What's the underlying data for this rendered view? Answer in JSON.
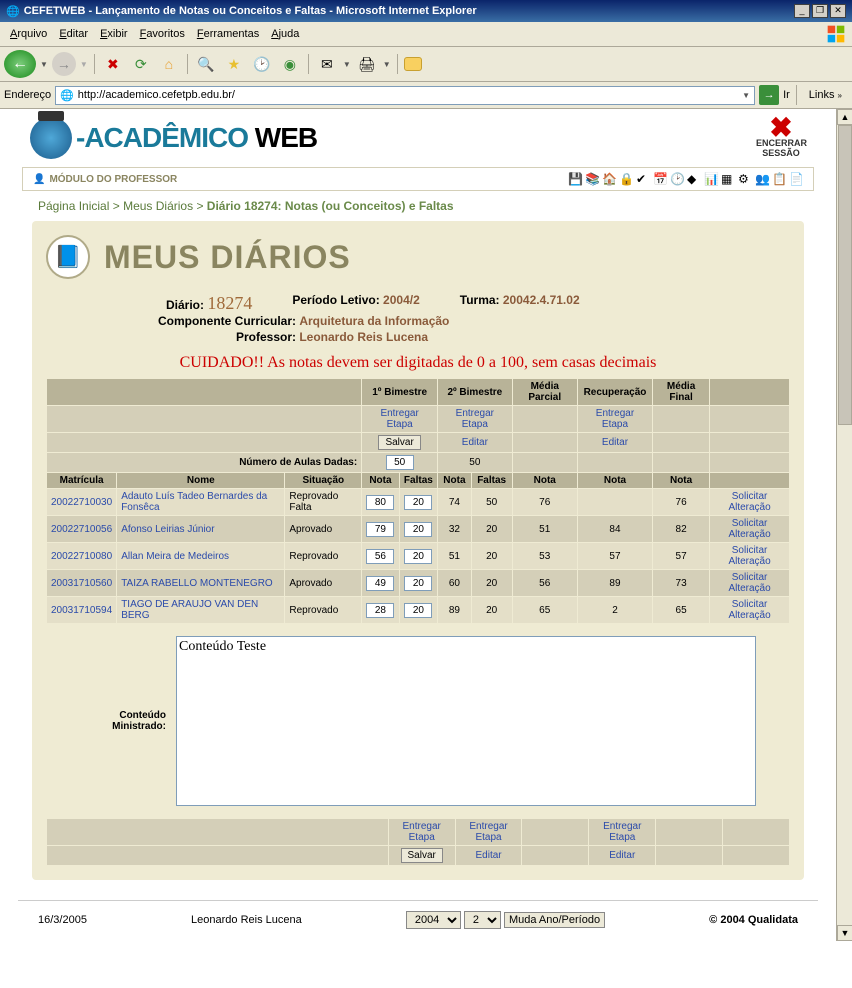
{
  "ie": {
    "title": "CEFETWEB - Lançamento de Notas ou Conceitos e Faltas - Microsoft Internet Explorer",
    "menus": [
      "Arquivo",
      "Editar",
      "Exibir",
      "Favoritos",
      "Ferramentas",
      "Ajuda"
    ],
    "address_label": "Endereço",
    "url": "http://academico.cefetpb.edu.br/",
    "go": "Ir",
    "links": "Links"
  },
  "header": {
    "logo1": "-ACADÊMICO ",
    "logo2": "WEB",
    "logout": "ENCERRAR SESSÃO"
  },
  "module": {
    "label": "MÓDULO DO PROFESSOR"
  },
  "breadcrumb": {
    "home": "Página Inicial",
    "diarios": "Meus Diários",
    "current": "Diário 18274: Notas (ou Conceitos) e Faltas",
    "sep": " > "
  },
  "panel": {
    "title": "MEUS DIÁRIOS"
  },
  "info": {
    "diario_lbl": "Diário:",
    "diario_val": "18274",
    "periodo_lbl": "Período Letivo:",
    "periodo_val": "2004/2",
    "turma_lbl": "Turma:",
    "turma_val": "20042.4.71.02",
    "componente_lbl": "Componente Curricular:",
    "componente_val": "Arquitetura da Informação",
    "professor_lbl": "Professor:",
    "professor_val": "Leonardo Reis Lucena"
  },
  "warning": "CUIDADO!! As notas devem ser digitadas de 0 a 100, sem casas decimais",
  "table": {
    "headers_top": [
      "",
      "1º Bimestre",
      "2º Bimestre",
      "Média Parcial",
      "Recuperação",
      "Média Final",
      ""
    ],
    "entregar": "Entregar Etapa",
    "salvar": "Salvar",
    "editar": "Editar",
    "aulas_lbl": "Número de Aulas Dadas:",
    "aulas_b1": "50",
    "aulas_b2": "50",
    "cols": [
      "Matrícula",
      "Nome",
      "Situação",
      "Nota",
      "Faltas",
      "Nota",
      "Faltas",
      "Nota",
      "Nota",
      "Nota",
      ""
    ],
    "solicitar": "Solicitar Alteração",
    "rows": [
      {
        "mat": "20022710030",
        "nome": "Adauto Luís Tadeo Bernardes da Fonsêca",
        "sit": "Reprovado Falta",
        "n1": "80",
        "f1": "20",
        "n2": "74",
        "f2": "50",
        "mp": "76",
        "rec": "",
        "mf": "76"
      },
      {
        "mat": "20022710056",
        "nome": "Afonso Leirias Júnior",
        "sit": "Aprovado",
        "n1": "79",
        "f1": "20",
        "n2": "32",
        "f2": "20",
        "mp": "51",
        "rec": "84",
        "mf": "82"
      },
      {
        "mat": "20022710080",
        "nome": "Allan Meira de Medeiros",
        "sit": "Reprovado",
        "n1": "56",
        "f1": "20",
        "n2": "51",
        "f2": "20",
        "mp": "53",
        "rec": "57",
        "mf": "57"
      },
      {
        "mat": "20031710560",
        "nome": "TAIZA RABELLO MONTENEGRO",
        "sit": "Aprovado",
        "n1": "49",
        "f1": "20",
        "n2": "60",
        "f2": "20",
        "mp": "56",
        "rec": "89",
        "mf": "73"
      },
      {
        "mat": "20031710594",
        "nome": "TIAGO DE ARAUJO VAN DEN BERG",
        "sit": "Reprovado",
        "n1": "28",
        "f1": "20",
        "n2": "89",
        "f2": "20",
        "mp": "65",
        "rec": "2",
        "mf": "65"
      }
    ]
  },
  "content": {
    "label": "Conteúdo Ministrado:",
    "value": "Conteúdo Teste"
  },
  "footer": {
    "date": "16/3/2005",
    "user": "Leonardo Reis Lucena",
    "year": "2004",
    "sem": "2",
    "btn": "Muda Ano/Período",
    "copy": "© 2004 Qualidata"
  }
}
